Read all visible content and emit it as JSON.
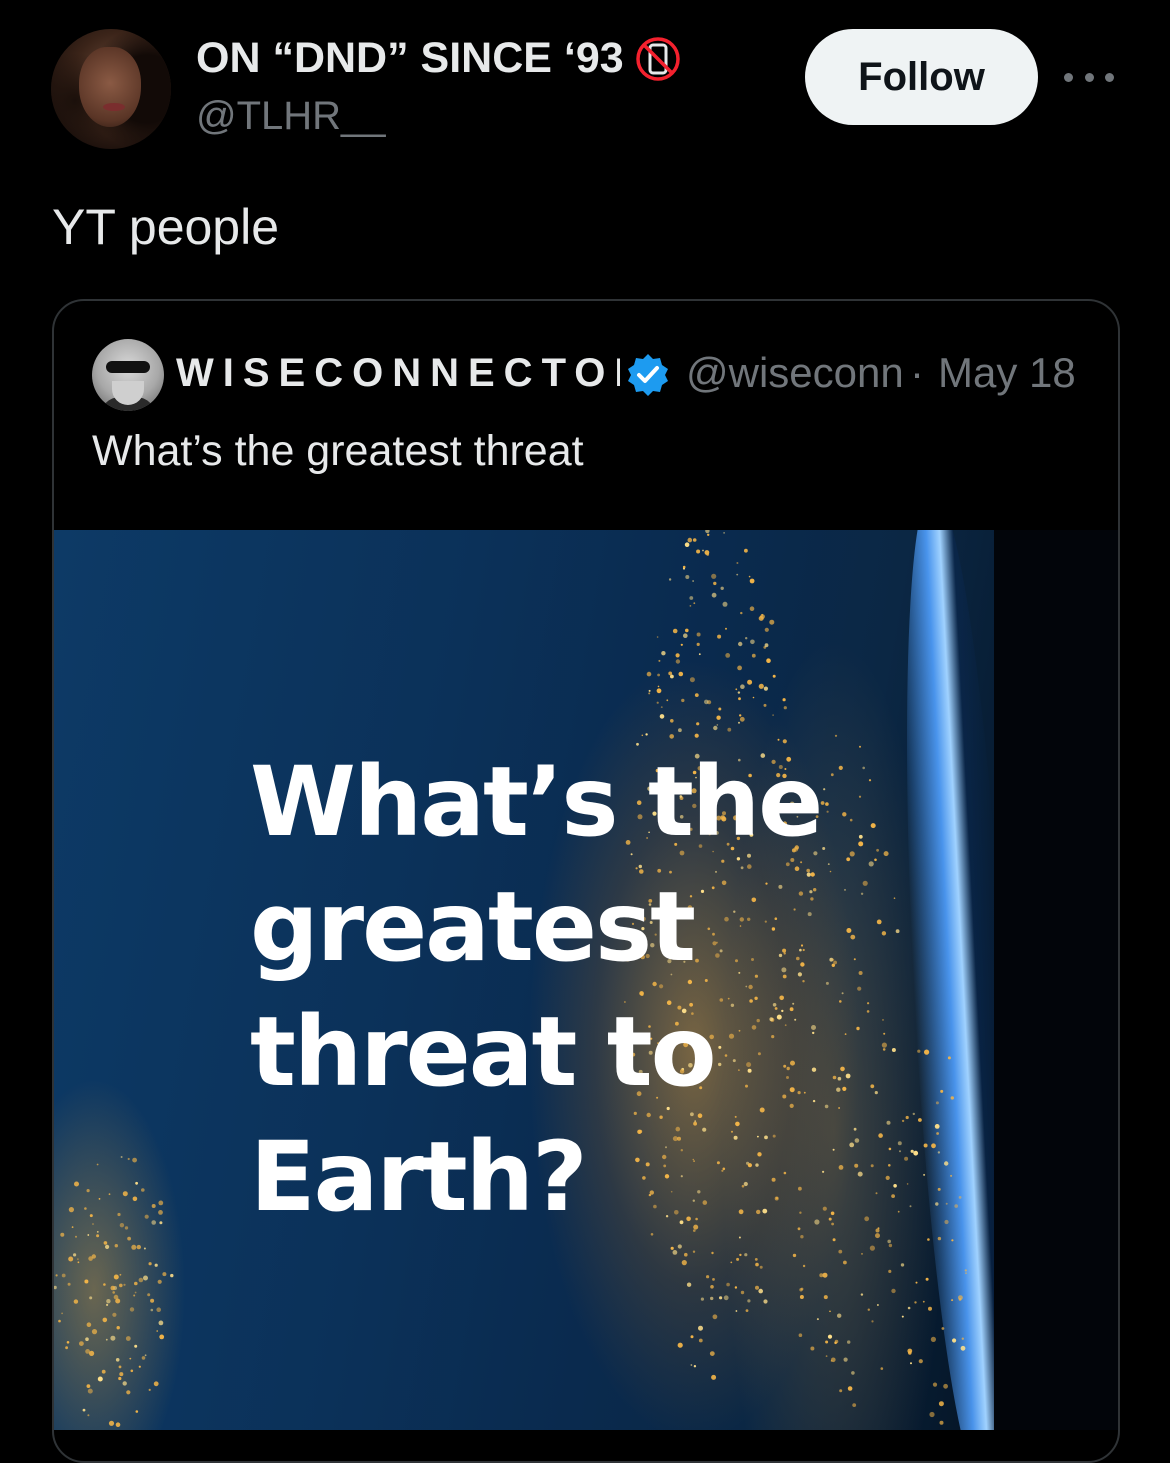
{
  "tweet": {
    "author": {
      "display_name": "ON “DND” SINCE ‘93",
      "handle": "@TLHR__",
      "badge_icon": "no-phone-icon"
    },
    "follow_label": "Follow",
    "more_icon": "more-horizontal-icon",
    "text": "YT people"
  },
  "quote": {
    "author": {
      "display_name": "WISECONNECTOR",
      "verified_icon": "verified-badge-icon",
      "handle": "@wiseconnect",
      "separator": "·",
      "date": "May 18"
    },
    "text": "What’s the greatest threat",
    "media": {
      "headline_lines": [
        "What’s the",
        "greatest",
        "threat to",
        "Earth?"
      ]
    }
  },
  "colors": {
    "background": "#000000",
    "text_primary": "#e7e9ea",
    "text_secondary": "#71767b",
    "border": "#2f3336",
    "follow_bg": "#eff3f4",
    "verified": "#1d9bf0",
    "no_phone_red": "#f4212e"
  }
}
